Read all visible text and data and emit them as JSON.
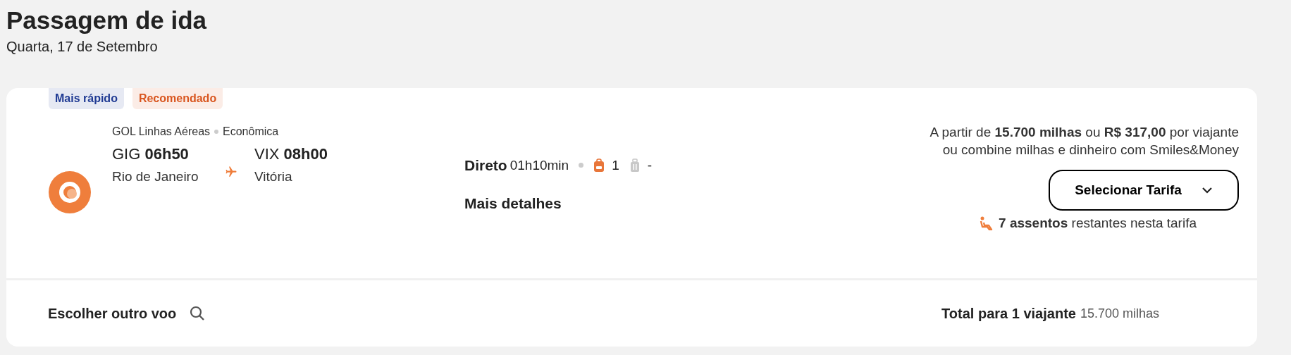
{
  "header": {
    "title": "Passagem de ida",
    "date": "Quarta, 17 de Setembro"
  },
  "badges": [
    {
      "label": "Mais rápido",
      "color": "#1f3a93"
    },
    {
      "label": "Recomendado",
      "color": "#d9561f"
    }
  ],
  "flight": {
    "airline": "GOL Linhas Aéreas",
    "cabin": "Econômica",
    "departure": {
      "code": "GIG",
      "time": "06h50",
      "city": "Rio de Janeiro"
    },
    "arrival": {
      "code": "VIX",
      "time": "08h00",
      "city": "Vitória"
    },
    "stops": "Direto",
    "duration": "01h10min",
    "baggage": [
      {
        "kind": "backpack",
        "included": true,
        "count": "1"
      },
      {
        "kind": "suitcase",
        "included": false,
        "count": "-"
      }
    ],
    "details_link": "Mais detalhes"
  },
  "fare": {
    "price": "A partir de **15.700 milhas** ou **R$ 317,00** por viajante",
    "combine": "ou combine milhas e dinheiro com Smiles&Money",
    "select_button": "Selecionar Tarifa",
    "seats": "**7 assentos** restantes nesta tarifa"
  },
  "footer": {
    "other_flight": "Escolher outro voo",
    "total_label": "Total para 1 viajante",
    "total_value": "15.700 milhas"
  }
}
